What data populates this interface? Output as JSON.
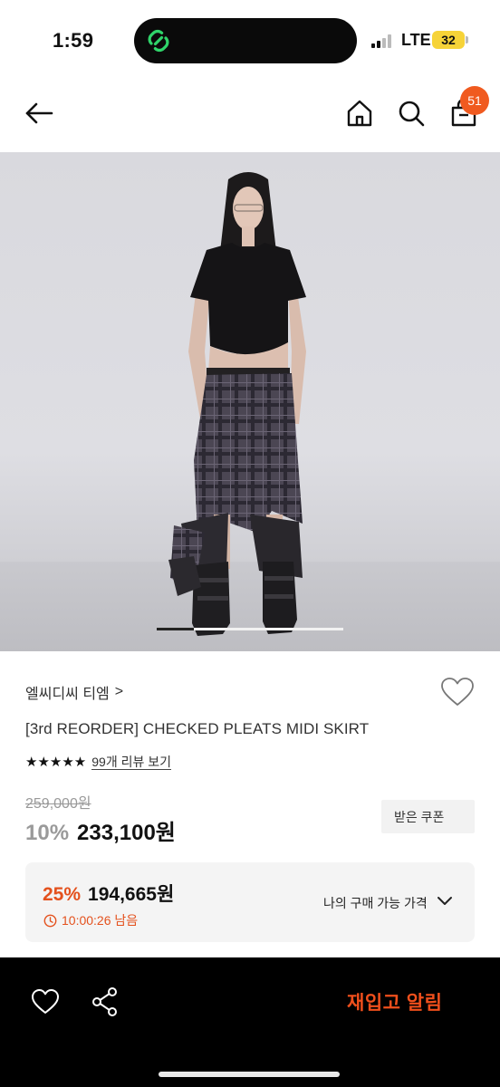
{
  "status_bar": {
    "time": "1:59",
    "network": "LTE",
    "battery": "32",
    "icons": [
      "signal-icon",
      "battery-icon",
      "app-link-icon"
    ]
  },
  "header": {
    "cart_badge": "51",
    "icons": [
      "back-arrow-icon",
      "home-icon",
      "search-icon",
      "cart-icon"
    ]
  },
  "gallery": {
    "progress_fraction": 0.2
  },
  "product": {
    "brand": "엘씨디씨 티엠",
    "brand_chevron": ">",
    "title": "[3rd REORDER] CHECKED PLEATS MIDI SKIRT",
    "stars": "★★★★★",
    "review_link": "99개 리뷰 보기",
    "original_price": "259,000원",
    "discount_rate": "10%",
    "sale_price": "233,100원",
    "coupon_label": "받은 쿠폰"
  },
  "my_price": {
    "rate": "25%",
    "price": "194,665원",
    "timer": "10:00:26 남음",
    "label": "나의 구매 가능 가격"
  },
  "bottom_bar": {
    "restock_label": "재입고 알림"
  },
  "colors": {
    "accent_orange": "#f05a1f",
    "discount_red": "#e4511d",
    "bottom_bar": "#000000"
  }
}
